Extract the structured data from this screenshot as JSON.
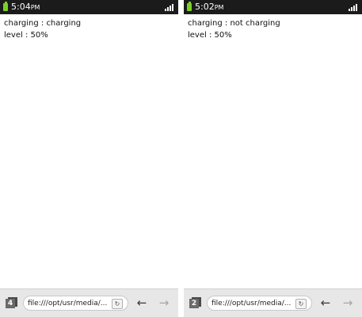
{
  "screens": [
    {
      "status": {
        "time": "5:04",
        "ampm": "PM"
      },
      "content": {
        "charging_line": "charging : charging",
        "level_line": "level : 50%"
      },
      "toolbar": {
        "tab_count": "4",
        "url": "file:///opt/usr/media/..."
      }
    },
    {
      "status": {
        "time": "5:02",
        "ampm": "PM"
      },
      "content": {
        "charging_line": "charging : not charging",
        "level_line": "level : 50%"
      },
      "toolbar": {
        "tab_count": "2",
        "url": "file:///opt/usr/media/..."
      }
    }
  ],
  "icons": {
    "battery": "battery-icon",
    "signal": "signal-icon",
    "tabs": "tabs-icon",
    "reload": "reload-icon",
    "back": "back-arrow-icon",
    "forward": "forward-arrow-icon"
  },
  "colors": {
    "status_bar": "#1b1b1b",
    "battery": "#7ccf2a",
    "toolbar": "#e7e7e7"
  }
}
